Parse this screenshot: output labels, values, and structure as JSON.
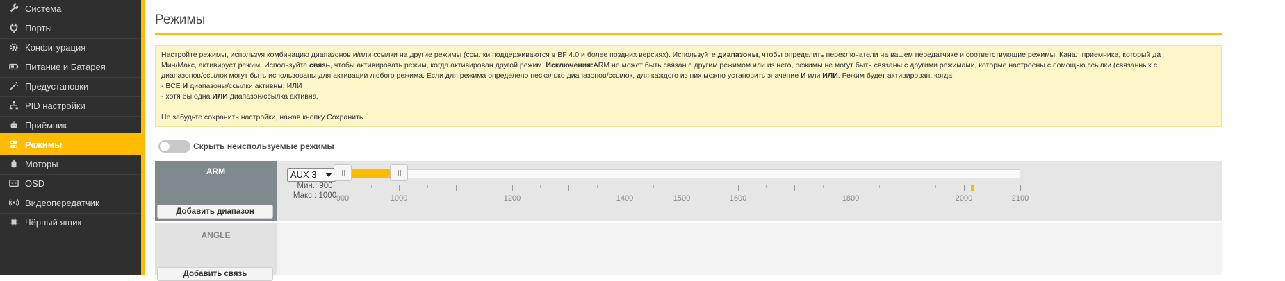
{
  "sidebar": {
    "items": [
      {
        "label": "Система",
        "icon": "wrench-icon"
      },
      {
        "label": "Порты",
        "icon": "plug-icon"
      },
      {
        "label": "Конфигурация",
        "icon": "gear-icon"
      },
      {
        "label": "Питание и Батарея",
        "icon": "battery-icon"
      },
      {
        "label": "Предустановки",
        "icon": "magic-wand-icon"
      },
      {
        "label": "PID настройки",
        "icon": "sitemap-icon"
      },
      {
        "label": "Приёмник",
        "icon": "robot-icon"
      },
      {
        "label": "Режимы",
        "icon": "toggle-icon",
        "active": true
      },
      {
        "label": "Моторы",
        "icon": "motor-icon"
      },
      {
        "label": "OSD",
        "icon": "osd-icon"
      },
      {
        "label": "Видеопередатчик",
        "icon": "broadcast-icon"
      },
      {
        "label": "Чёрный ящик",
        "icon": "chip-icon"
      }
    ],
    "accent": "#ffbb00"
  },
  "main": {
    "title": "Режимы",
    "note": {
      "p1_a": "Настройте режимы, используя комбинацию диапазонов и/или ссылки на другие режимы (ссылки поддерживаются в BF 4.0 и более поздних версиях). Используйте ",
      "p1_b": "диапазоны",
      "p1_c": ", чтобы определить переключатели на вашем передатчике и соответствующие режимы. Канал приемника, который да",
      "p2_a": "Мин/Макс, активирует режим. Используйте ",
      "p2_b": "связь",
      "p2_c": ", чтобы активировать режим, когда активирован другой режим. ",
      "p2_d": "Исключения:",
      "p2_e": "ARM не может быть связан с другим режимом или из него, режимы не могут быть связаны с другими режимами, которые настроены с помощью ссылки (связанных с",
      "p3_a": "диапазонов/ссылок могут быть использованы для активации любого режима. Если для режима определено несколько диапазонов/ссылок, для каждого из них можно установить значение ",
      "p3_b": "И",
      "p3_c": " или ",
      "p3_d": "ИЛИ",
      "p3_e": ". Режим будет активирован, когда:",
      "p4_a": "- ВСЕ ",
      "p4_b": "И",
      "p4_c": " диапазоны/ссылки активны; ИЛИ",
      "p5_a": "- хотя бы одна ",
      "p5_b": "ИЛИ",
      "p5_c": " диапазон/ссылка активна.",
      "p6": "Не забудьте сохранить настройки, нажав кнопку Сохранить."
    },
    "hide_unused_label": "Скрыть неиспользуемые режимы"
  },
  "modes": [
    {
      "name": "ARM",
      "add_range_label": "Добавить диапазон",
      "channel": "AUX 3",
      "min_label": "Мин.: 900",
      "max_label": "Макс.: 1000",
      "range_min": 900,
      "range_max": 1000,
      "current_value": 2015,
      "scale_labels": [
        "900",
        "1000",
        "1200",
        "1400",
        "1500",
        "1600",
        "1800",
        "2000",
        "2100"
      ]
    },
    {
      "name": "ANGLE",
      "add_link_label": "Добавить связь"
    }
  ]
}
